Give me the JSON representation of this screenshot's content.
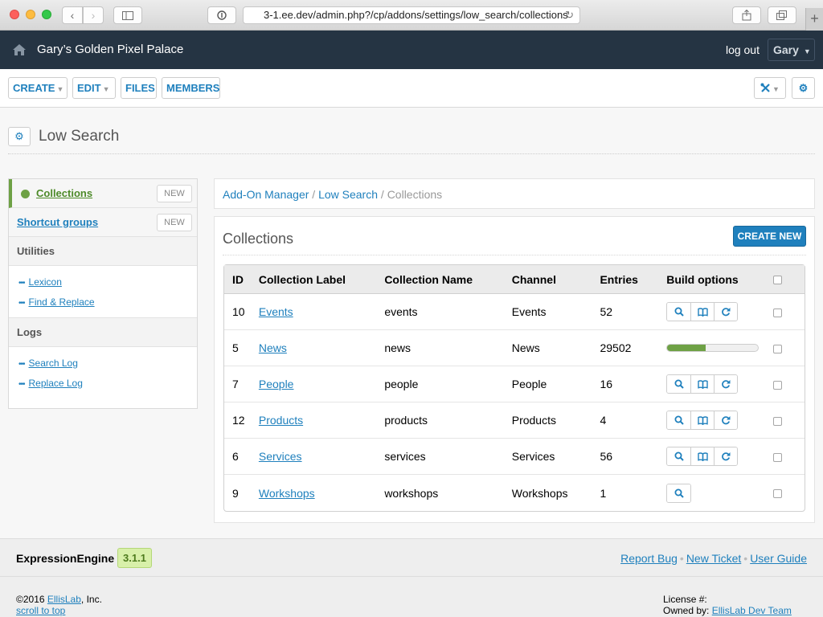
{
  "browser": {
    "url": "3-1.ee.dev/admin.php?/cp/addons/settings/low_search/collections"
  },
  "header": {
    "site_name": "Gary’s Golden Pixel Palace",
    "logout": "log out",
    "user": "Gary"
  },
  "toolbar": {
    "create": "CREATE",
    "edit": "EDIT",
    "files": "FILES",
    "members": "MEMBERS"
  },
  "page": {
    "title": "Low Search"
  },
  "sidebar": {
    "items": [
      {
        "label": "Collections",
        "new": "NEW",
        "active": true
      },
      {
        "label": "Shortcut groups",
        "new": "NEW",
        "active": false
      }
    ],
    "sections": [
      {
        "title": "Utilities",
        "links": [
          "Lexicon",
          "Find & Replace"
        ]
      },
      {
        "title": "Logs",
        "links": [
          "Search Log",
          "Replace Log"
        ]
      }
    ]
  },
  "breadcrumb": {
    "items": [
      "Add-On Manager",
      "Low Search"
    ],
    "current": "Collections",
    "separator": "/"
  },
  "main": {
    "title": "Collections",
    "create_new": "CREATE NEW",
    "columns": [
      "ID",
      "Collection Label",
      "Collection Name",
      "Channel",
      "Entries",
      "Build options"
    ],
    "rows": [
      {
        "id": "10",
        "label": "Events",
        "name": "events",
        "channel": "Events",
        "entries": "52",
        "build": [
          "search",
          "book",
          "refresh"
        ]
      },
      {
        "id": "5",
        "label": "News",
        "name": "news",
        "channel": "News",
        "entries": "29502",
        "build": [],
        "progress": 0.42
      },
      {
        "id": "7",
        "label": "People",
        "name": "people",
        "channel": "People",
        "entries": "16",
        "build": [
          "search",
          "book",
          "refresh"
        ]
      },
      {
        "id": "12",
        "label": "Products",
        "name": "products",
        "channel": "Products",
        "entries": "4",
        "build": [
          "search",
          "book",
          "refresh"
        ]
      },
      {
        "id": "6",
        "label": "Services",
        "name": "services",
        "channel": "Services",
        "entries": "56",
        "build": [
          "search",
          "book",
          "refresh"
        ]
      },
      {
        "id": "9",
        "label": "Workshops",
        "name": "workshops",
        "channel": "Workshops",
        "entries": "1",
        "build": [
          "search"
        ]
      }
    ]
  },
  "footer": {
    "product": "ExpressionEngine",
    "version": "3.1.1",
    "links": [
      "Report Bug",
      "New Ticket",
      "User Guide"
    ],
    "copyright_prefix": "©2016 ",
    "copyright_link": "EllisLab",
    "copyright_suffix": ", Inc.",
    "scroll_to_top": "scroll to top",
    "license": "License #:",
    "owned_by_prefix": "Owned by: ",
    "owned_by": "EllisLab Dev Team"
  },
  "colors": {
    "header_bg": "#253443",
    "accent": "#1f80bd",
    "success": "#6ea145"
  }
}
